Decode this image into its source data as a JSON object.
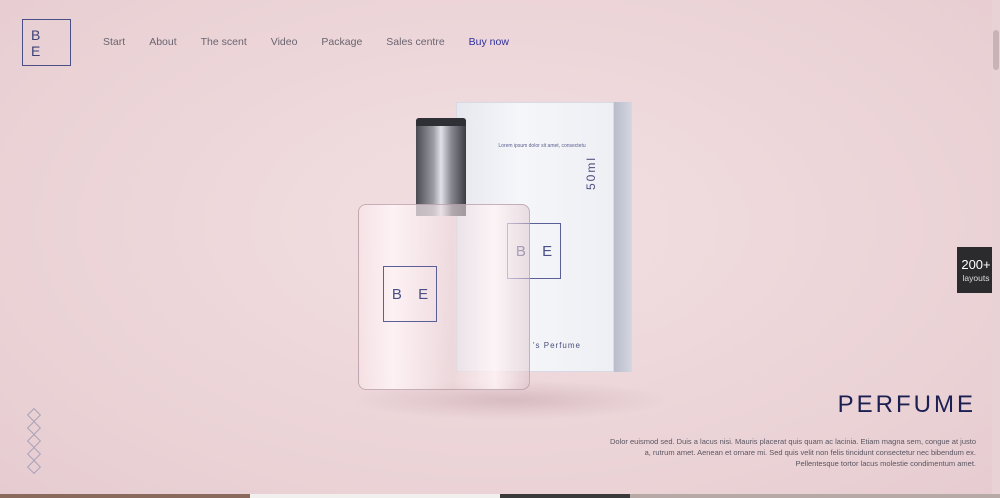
{
  "logo": {
    "text": "B E"
  },
  "nav": {
    "items": [
      {
        "label": "Start"
      },
      {
        "label": "About"
      },
      {
        "label": "The scent"
      },
      {
        "label": "Video"
      },
      {
        "label": "Package"
      },
      {
        "label": "Sales centre"
      },
      {
        "label": "Buy now"
      }
    ]
  },
  "badge": {
    "count": "200+",
    "label": "layouts"
  },
  "product": {
    "bottle_logo": "B E",
    "box_logo": "B E",
    "box_size": "50ml",
    "box_caption": "Lorem ipsum dolor sit amet, consectetu",
    "box_name": "'s Perfume"
  },
  "hero": {
    "headline": "PERFUME",
    "description": "Dolor euismod sed. Duis a lacus nisi. Mauris placerat quis quam ac lacinia. Etiam magna sem, congue at justo a, rutrum amet. Aenean et ornare mi. Sed quis velit non felis tincidunt consectetur nec bibendum ex. Pellentesque tortor lacus molestie condimentum amet."
  },
  "colors": {
    "accent": "#2f2f9e",
    "headline": "#1b1f52",
    "background": "#efd9dc"
  },
  "slider": {
    "dot_count": 5
  }
}
